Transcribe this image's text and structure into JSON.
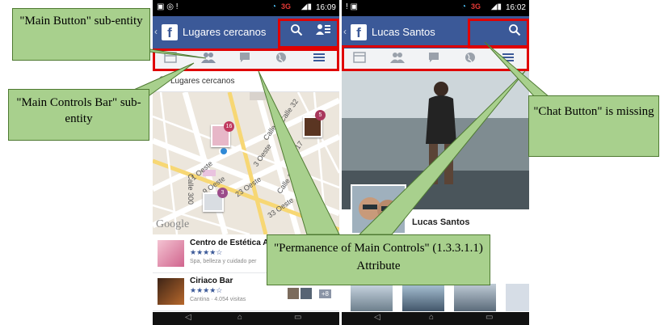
{
  "phone1": {
    "status": {
      "time": "16:09",
      "network": "3G"
    },
    "appbar": {
      "title": "Lugares cercanos",
      "back_glyph": "‹",
      "logo": "f"
    },
    "search": {
      "text": "Lugares cercanos"
    },
    "map": {
      "google": "Google",
      "streets": [
        "Calle 32",
        "Calle 21",
        "Calle 17",
        "Calle 2",
        "Calle 300",
        "1 Oeste",
        "9 Oeste",
        "23 Oeste",
        "33 Oeste",
        "3 Oeste"
      ],
      "badges": [
        "16",
        "5",
        "3"
      ]
    },
    "places": [
      {
        "name": "Centro de Estética A",
        "stars": "★★★★☆",
        "meta": "Spa, belleza y cuidado per"
      },
      {
        "name": "Ciriaco Bar",
        "stars": "★★★★☆",
        "meta": "Cantina · 4.054 visitas",
        "more": "+8"
      }
    ]
  },
  "phone2": {
    "status": {
      "time": "16:02",
      "network": "3G"
    },
    "appbar": {
      "title": "Lucas Santos",
      "back_glyph": "‹",
      "logo": "f"
    },
    "profile_name": "Lucas Santos"
  },
  "callouts": {
    "main_button": "\"Main Button\" sub-entity",
    "main_controls": "\"Main Controls Bar\" sub-entity",
    "permanence": "\"Permanence of Main Controls\" (1.3.3.1.1) Attribute",
    "chat": "\"Chat Button\" is missing"
  },
  "icons": {
    "search": "search-icon",
    "friend_requests": "friend-requests-icon",
    "feed": "feed-icon",
    "friends": "friends-icon",
    "messages": "messages-icon",
    "globe": "globe-icon",
    "menu": "menu-icon"
  },
  "colors": {
    "facebook_blue": "#3b5998",
    "callout_green": "#a8d08d",
    "highlight_red": "#e00000"
  }
}
